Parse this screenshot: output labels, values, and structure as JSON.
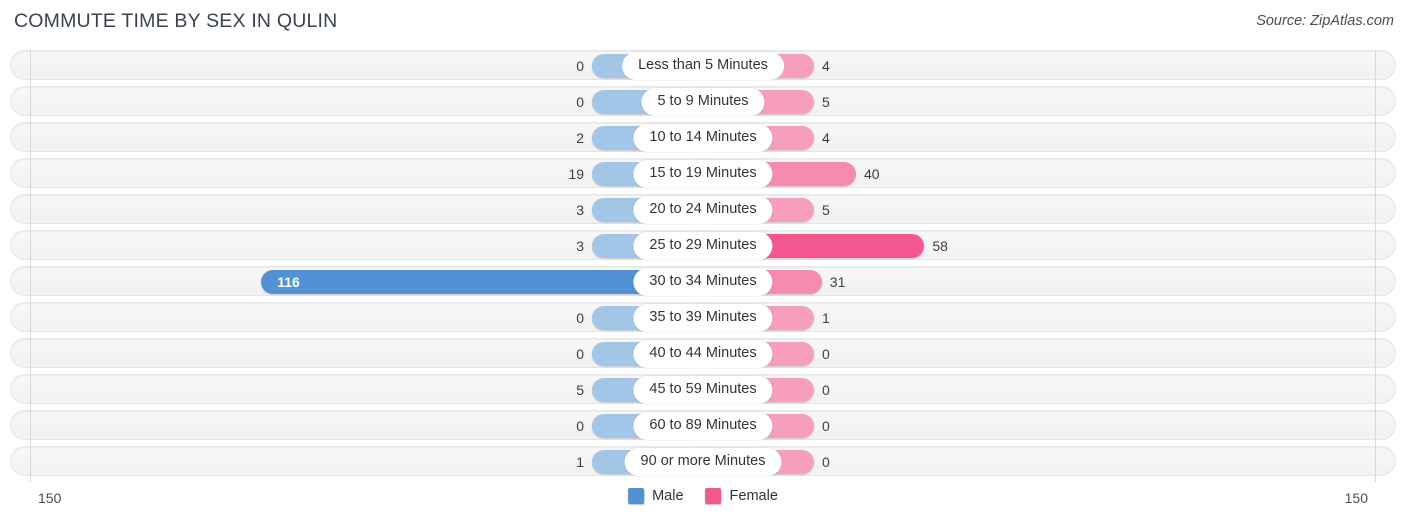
{
  "header": {
    "title": "COMMUTE TIME BY SEX IN QULIN",
    "source": "Source: ZipAtlas.com"
  },
  "axis": {
    "left_tick": "150",
    "right_tick": "150",
    "max": 150
  },
  "legend": {
    "male_label": "Male",
    "female_label": "Female",
    "male_color": "#5292d4",
    "female_color": "#f2578f"
  },
  "colors": {
    "male_light": "#a3c6e8",
    "male_dark": "#5292d4",
    "female_light": "#f79ebd",
    "female_mid": "#f58cb0",
    "female_dark": "#f2578f",
    "track": "#f4f4f4",
    "axis_line": "#d8d8d8"
  },
  "chart_data": {
    "type": "bar",
    "orientation": "diverging-horizontal",
    "title": "COMMUTE TIME BY SEX IN QULIN",
    "xlabel": "",
    "ylabel": "",
    "xlim": [
      150,
      150
    ],
    "grid": false,
    "legend_position": "bottom-center",
    "categories": [
      "Less than 5 Minutes",
      "5 to 9 Minutes",
      "10 to 14 Minutes",
      "15 to 19 Minutes",
      "20 to 24 Minutes",
      "25 to 29 Minutes",
      "30 to 34 Minutes",
      "35 to 39 Minutes",
      "40 to 44 Minutes",
      "45 to 59 Minutes",
      "60 to 89 Minutes",
      "90 or more Minutes"
    ],
    "series": [
      {
        "name": "Male",
        "values": [
          0,
          0,
          2,
          19,
          3,
          3,
          116,
          0,
          0,
          5,
          0,
          1
        ]
      },
      {
        "name": "Female",
        "values": [
          4,
          5,
          4,
          40,
          5,
          58,
          31,
          1,
          0,
          0,
          0,
          0
        ]
      }
    ]
  },
  "rows": [
    {
      "category": "Less than 5 Minutes",
      "male": "0",
      "female": "4"
    },
    {
      "category": "5 to 9 Minutes",
      "male": "0",
      "female": "5"
    },
    {
      "category": "10 to 14 Minutes",
      "male": "2",
      "female": "4"
    },
    {
      "category": "15 to 19 Minutes",
      "male": "19",
      "female": "40"
    },
    {
      "category": "20 to 24 Minutes",
      "male": "3",
      "female": "5"
    },
    {
      "category": "25 to 29 Minutes",
      "male": "3",
      "female": "58"
    },
    {
      "category": "30 to 34 Minutes",
      "male": "116",
      "female": "31"
    },
    {
      "category": "35 to 39 Minutes",
      "male": "0",
      "female": "1"
    },
    {
      "category": "40 to 44 Minutes",
      "male": "0",
      "female": "0"
    },
    {
      "category": "45 to 59 Minutes",
      "male": "5",
      "female": "0"
    },
    {
      "category": "60 to 89 Minutes",
      "male": "0",
      "female": "0"
    },
    {
      "category": "90 or more Minutes",
      "male": "1",
      "female": "0"
    }
  ]
}
